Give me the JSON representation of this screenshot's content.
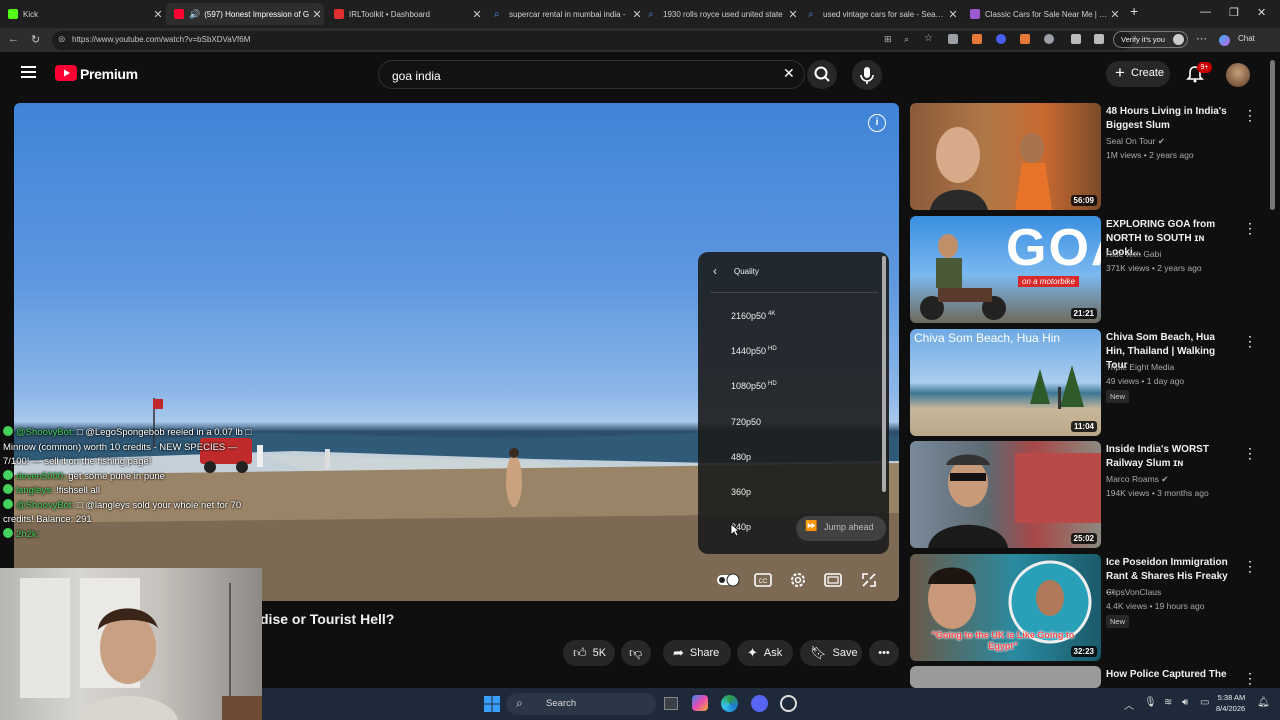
{
  "browser": {
    "tabs": [
      {
        "label": "Kick",
        "color": "#53fc18"
      },
      {
        "label": "(597) Honest Impression of G",
        "color": "#ff0033"
      },
      {
        "label": "IRLToolkit • Dashboard",
        "color": "#e02f2f"
      },
      {
        "label": "supercar rental in mumbai india -",
        "color": "#4f8df5"
      },
      {
        "label": "1930 rolls royce used united state",
        "color": "#4f8df5"
      },
      {
        "label": "used vintage cars for sale - Search",
        "color": "#4f8df5"
      },
      {
        "label": "Classic Cars for Sale Near Me | Ca",
        "color": "#9b59d0"
      }
    ],
    "url": "https://www.youtube.com/watch?v=bSbXDVaVf6M",
    "verify_label": "Verify it's you",
    "chat_label": "Chat"
  },
  "youtube": {
    "brand": "Premium",
    "search_value": "goa india",
    "create_label": "Create",
    "notif_badge": "9+"
  },
  "quality_menu": {
    "title": "Quality",
    "options": [
      {
        "label": "2160p50",
        "tag": "4K"
      },
      {
        "label": "1440p50",
        "tag": "HD"
      },
      {
        "label": "1080p50",
        "tag": "HD"
      },
      {
        "label": "720p50",
        "tag": ""
      },
      {
        "label": "480p",
        "tag": ""
      },
      {
        "label": "360p",
        "tag": ""
      },
      {
        "label": "240p",
        "tag": ""
      }
    ],
    "jump_ahead": "Jump ahead"
  },
  "video": {
    "title_visible": "dise or Tourist Hell?",
    "likes": "5K",
    "share_label": "Share",
    "ask_label": "Ask",
    "save_label": "Save"
  },
  "chat": [
    {
      "user": "@ShoovyBot:",
      "text": " □ @LegoSpongebob reeled in a 0.07 lb □ Minnow (common) worth 10 credits - NEW SPECIES — 7/100! — sell it on the fishing page!"
    },
    {
      "user": "deven5000:",
      "text": " get some pune in pune"
    },
    {
      "user": "langleys:",
      "text": " !fishsell all"
    },
    {
      "user": "@ShoovyBot:",
      "text": " □ @langleys sold your whole net for 70 credits! Balance: 291"
    },
    {
      "user": "2h2k:",
      "text": ""
    }
  ],
  "recommendations": [
    {
      "title": "48 Hours Living in India's Biggest Slum",
      "channel": "Seal On Tour",
      "verified": true,
      "meta": "1M views • 2 years ago",
      "duration": "56:09",
      "new": false
    },
    {
      "title": "EXPLORING GOA from NORTH to SOUTH ɪɴ Looki...",
      "channel": "Ride with Gabi",
      "verified": false,
      "meta": "371K views • 2 years ago",
      "duration": "21:21",
      "new": false,
      "thumb_text": "GOA",
      "thumb_sub": "on a motorbike"
    },
    {
      "title": "Chiva Som Beach, Hua Hin, Thailand | Walking Tour",
      "channel": "Triple Eight Media",
      "verified": false,
      "meta": "49 views • 1 day ago",
      "duration": "11:04",
      "new": true,
      "thumb_text": "Chiva Som Beach, Hua Hin"
    },
    {
      "title": "Inside India's WORST Railway Slum ɪɴ",
      "channel": "Marco Roams",
      "verified": true,
      "meta": "194K views • 3 months ago",
      "duration": "25:02",
      "new": false
    },
    {
      "title": "Ice Poseidon Immigration Rant & Shares His Freaky ...",
      "channel": "ClipsVonClaus",
      "verified": false,
      "meta": "4.4K views • 19 hours ago",
      "duration": "32:23",
      "new": true,
      "thumb_text": "\"Going to the UK is Like Going to Egypt\""
    },
    {
      "title": "How Police Captured The",
      "channel": "",
      "verified": false,
      "meta": "",
      "duration": "",
      "new": false
    }
  ],
  "new_label": "New",
  "taskbar": {
    "search_label": "Search",
    "time": "5:38 AM",
    "date": "8/4/2026"
  }
}
